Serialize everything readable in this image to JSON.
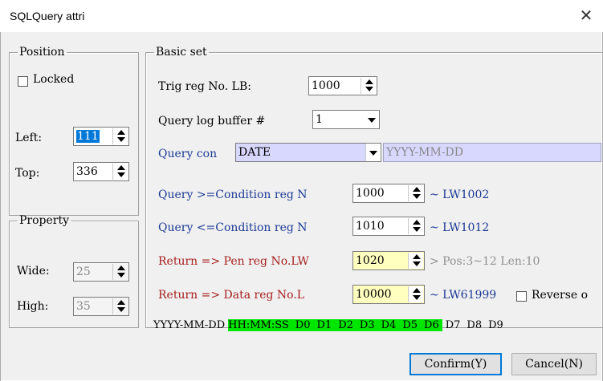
{
  "window": {
    "title": "SQLQuery attri"
  },
  "position": {
    "legend": "Position",
    "locked_label": "Locked",
    "left_label": "Left:",
    "left_value": "111",
    "top_label": "Top:",
    "top_value": "336"
  },
  "property": {
    "legend": "Property",
    "wide_label": "Wide:",
    "wide_value": "25",
    "high_label": "High:",
    "high_value": "35"
  },
  "basic": {
    "legend": "Basic set",
    "trig_label": "Trig reg No. LB:",
    "trig_value": "1000",
    "log_label": "Query log buffer #",
    "log_value": "1",
    "cond_label": "Query con",
    "cond_value": "DATE",
    "cond_format": "YYYY-MM-DD",
    "ge_label": "Query >=Condition reg N",
    "ge_value": "1000",
    "ge_range": "~ LW1002",
    "le_label": "Query <=Condition reg N",
    "le_value": "1010",
    "le_range": "~ LW1012",
    "pen_label": "Return => Pen reg No.LW",
    "pen_value": "1020",
    "pen_info": "> Pos:3~12 Len:10",
    "data_label": "Return => Data reg No.L",
    "data_value": "10000",
    "data_range": "~ LW61999",
    "reverse_label": "Reverse o"
  },
  "columns": {
    "date": "YYYY-MM-DD",
    "highlighted": [
      "HH:MM:SS",
      "D0",
      "D1",
      "D2",
      "D3",
      "D4",
      "D5",
      "D6"
    ],
    "plain": [
      "D7",
      "D8",
      "D9"
    ],
    "highlight_color": "#00e600"
  },
  "buttons": {
    "confirm": "Confirm(Y)",
    "cancel": "Cancel(N)"
  }
}
